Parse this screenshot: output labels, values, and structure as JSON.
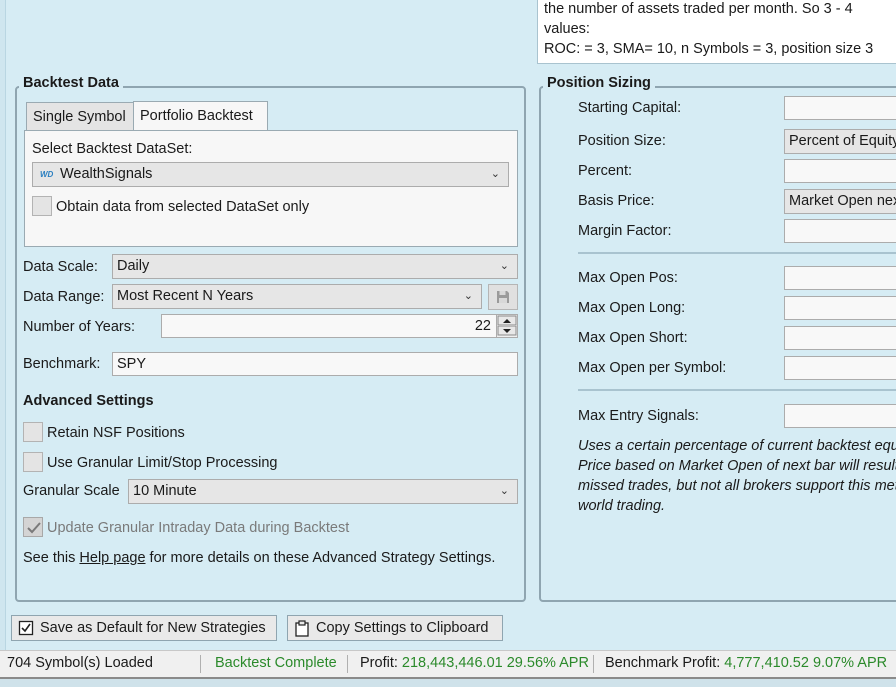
{
  "description": {
    "line1": "the number of assets traded per month. So 3 - 4",
    "line2": "values:",
    "line3": "ROC: = 3, SMA= 10, n Symbols = 3, position size 3"
  },
  "backtest": {
    "title": "Backtest Data",
    "tabs": [
      "Single Symbol",
      "Portfolio Backtest"
    ],
    "select_dataset_label": "Select Backtest DataSet:",
    "dataset_logo": "WD",
    "dataset_value": "WealthSignals",
    "obtain_label": "Obtain data from selected DataSet only",
    "data_scale_label": "Data Scale:",
    "data_scale_value": "Daily",
    "data_range_label": "Data Range:",
    "data_range_value": "Most Recent N Years",
    "years_label": "Number of Years:",
    "years_value": "22",
    "benchmark_label": "Benchmark:",
    "benchmark_value": "SPY"
  },
  "advanced": {
    "title": "Advanced Settings",
    "retain_label": "Retain NSF Positions",
    "granular_label": "Use Granular Limit/Stop Processing",
    "granular_scale_label": "Granular Scale",
    "granular_scale_value": "10 Minute",
    "update_label": "Update Granular Intraday Data during Backtest",
    "see_prefix": "See this ",
    "help_link": "Help page",
    "see_suffix": " for more details on these Advanced Strategy Settings."
  },
  "position": {
    "title": "Position Sizing",
    "starting_capital_label": "Starting Capital:",
    "position_size_label": "Position Size:",
    "position_size_value": "Percent of Equity",
    "percent_label": "Percent:",
    "basis_price_label": "Basis Price:",
    "basis_price_value": "Market Open next bar",
    "margin_label": "Margin Factor:",
    "max_open_pos_label": "Max Open Pos:",
    "max_open_long_label": "Max Open Long:",
    "max_open_short_label": "Max Open Short:",
    "max_open_symbol_label": "Max Open per Symbol:",
    "max_entry_label": "Max Entry Signals:",
    "note1": "Uses a certain percentage of current backtest equity.",
    "note2": "Price based on Market Open of next bar will result in",
    "note3": "missed trades, but not all brokers support this method",
    "note4": "world trading."
  },
  "buttons": {
    "save_default": "Save as Default for New Strategies",
    "copy_clipboard": "Copy Settings to Clipboard"
  },
  "status": {
    "symbols_loaded": "704 Symbol(s) Loaded",
    "backtest_state": "Backtest Complete",
    "profit_label": "Profit: ",
    "profit_value": "218,443,446.01 29.56% APR",
    "benchmark_label": "Benchmark Profit: ",
    "benchmark_value": "4,777,410.52 9.07% APR"
  },
  "colors": {
    "background": "#d6ecf4",
    "status_green": "#2b8a2b"
  }
}
